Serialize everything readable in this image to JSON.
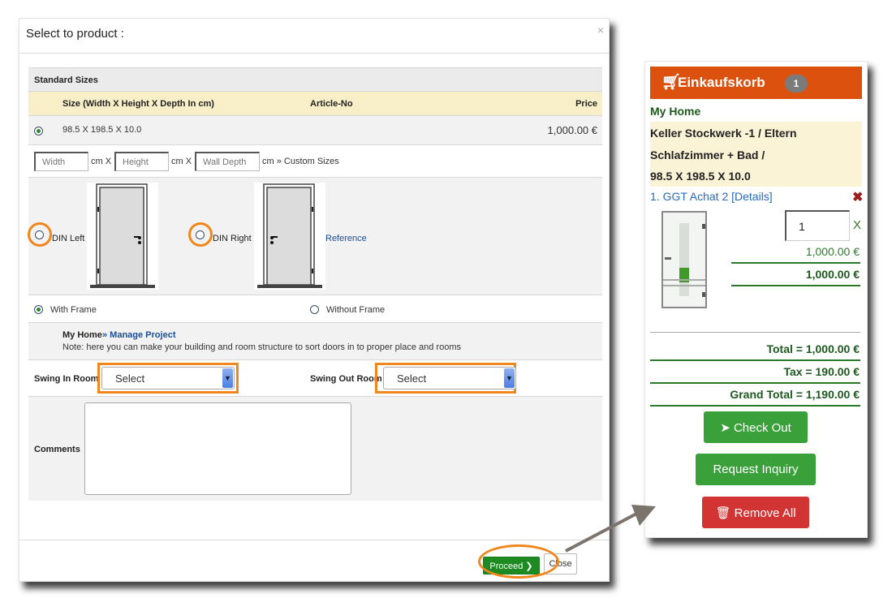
{
  "dialog": {
    "title": "Select to product :",
    "close_glyph": "×",
    "standard_sizes_label": "Standard Sizes",
    "columns": {
      "size": "Size (Width X Height X Depth In cm)",
      "article": "Article-No",
      "price": "Price"
    },
    "sizes": [
      {
        "selected": true,
        "size": "98.5 X 198.5 X 10.0",
        "article": "",
        "price": "1,000.00 €"
      }
    ],
    "custom": {
      "width_placeholder": "Width",
      "height_placeholder": "Height",
      "depth_placeholder": "Wall Depth",
      "unit_x1": "cm X",
      "unit_x2": "cm X",
      "unit_end": "cm » Custom Sizes"
    },
    "din": {
      "left_label": "DIN Left",
      "right_label": "DIN Right",
      "left_selected": false,
      "right_selected": false,
      "reference_link": "Reference"
    },
    "frame": {
      "with_label": "With Frame",
      "without_label": "Without Frame",
      "selected": "with"
    },
    "project": {
      "home": "My Home",
      "manage_link": "» Manage Project",
      "note": "Note: here you can make your building and room structure to sort doors in to proper place and rooms"
    },
    "swing": {
      "in_label": "Swing In Room",
      "in_value": "Select",
      "out_label": "Swing Out Room",
      "out_value": "Select"
    },
    "comments": {
      "label": "Comments",
      "value": ""
    },
    "footer": {
      "proceed_label": "Proceed ❯",
      "close_label": "Close"
    }
  },
  "cart": {
    "icon": "shopping-cart-icon",
    "title": "Einkaufskorb",
    "count": "1",
    "project": "My Home",
    "path_lines": [
      "Keller Stockwerk -1 / Eltern",
      "Schlafzimmer + Bad /",
      "98.5 X 198.5 X 10.0"
    ],
    "item": {
      "label": "1. GGT Achat 2 [Details]",
      "remove_glyph": "✖",
      "quantity": "1",
      "qty_x": "X",
      "unit_price": "1,000.00 €",
      "line_total": "1,000.00 €"
    },
    "totals": {
      "total": "Total = 1,000.00 €",
      "tax": "Tax = 190.00 €",
      "grand_total": "Grand Total = 1,190.00 €"
    },
    "buttons": {
      "checkout": "Check Out",
      "inquiry": "Request Inquiry",
      "remove_all": "Remove All"
    }
  },
  "colors": {
    "cart_header": "#dd510f",
    "accent_green": "#1e8a22",
    "highlight_orange": "#f0861c",
    "danger_red": "#d23434"
  }
}
